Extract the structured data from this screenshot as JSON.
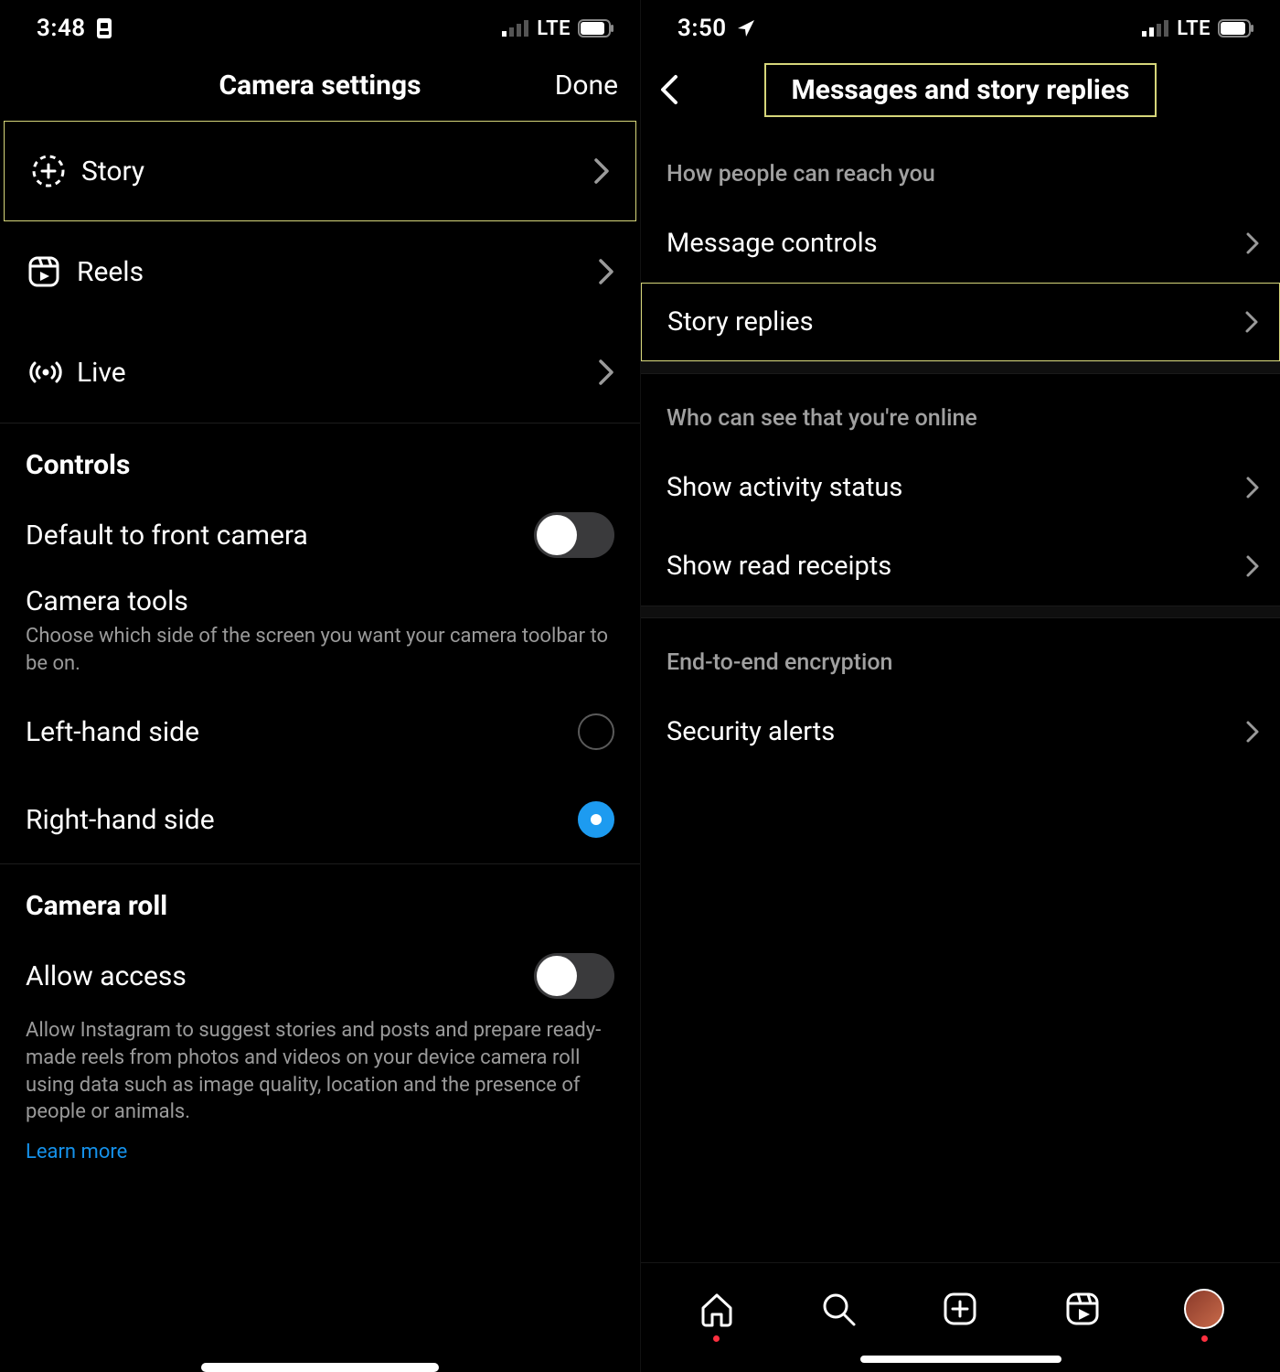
{
  "left": {
    "status": {
      "time": "3:48",
      "network": "LTE"
    },
    "header": {
      "title": "Camera settings",
      "done": "Done"
    },
    "modes": [
      {
        "key": "story",
        "label": "Story"
      },
      {
        "key": "reels",
        "label": "Reels"
      },
      {
        "key": "live",
        "label": "Live"
      }
    ],
    "controls": {
      "section": "Controls",
      "front_camera": {
        "label": "Default to front camera",
        "enabled": false
      },
      "tools": {
        "title": "Camera tools",
        "desc": "Choose which side of the screen you want your camera toolbar to be on.",
        "options": [
          {
            "key": "left",
            "label": "Left-hand side",
            "selected": false
          },
          {
            "key": "right",
            "label": "Right-hand side",
            "selected": true
          }
        ]
      }
    },
    "camera_roll": {
      "section": "Camera roll",
      "allow": {
        "label": "Allow access",
        "enabled": false,
        "desc": "Allow Instagram to suggest stories and posts and prepare ready-made reels from photos and videos on your device camera roll using data such as image quality, location and the presence of people or animals.",
        "learn_more": "Learn more"
      }
    }
  },
  "right": {
    "status": {
      "time": "3:50",
      "network": "LTE"
    },
    "header": {
      "title": "Messages and story replies"
    },
    "groups": [
      {
        "header": "How people can reach you",
        "items": [
          {
            "key": "message-controls",
            "label": "Message controls"
          },
          {
            "key": "story-replies",
            "label": "Story replies",
            "highlight": true
          }
        ]
      },
      {
        "header": "Who can see that you're online",
        "items": [
          {
            "key": "activity-status",
            "label": "Show activity status"
          },
          {
            "key": "read-receipts",
            "label": "Show read receipts"
          }
        ]
      },
      {
        "header": "End-to-end encryption",
        "items": [
          {
            "key": "security-alerts",
            "label": "Security alerts"
          }
        ]
      }
    ],
    "tabs": [
      "home",
      "search",
      "create",
      "reels",
      "profile"
    ]
  }
}
